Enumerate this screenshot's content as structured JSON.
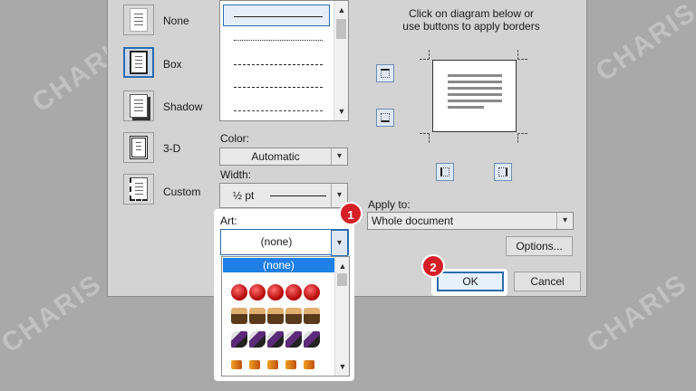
{
  "settings": [
    {
      "label": "None"
    },
    {
      "label": "Box"
    },
    {
      "label": "Shadow"
    },
    {
      "label": "3-D"
    },
    {
      "label": "Custom"
    }
  ],
  "color": {
    "label": "Color:",
    "value": "Automatic"
  },
  "width": {
    "label": "Width:",
    "value": "½ pt"
  },
  "art": {
    "label": "Art:",
    "value": "(none)",
    "list_selected": "(none)"
  },
  "preview": {
    "instructions_line1": "Click on diagram below or",
    "instructions_line2": "use buttons to apply borders"
  },
  "apply_to": {
    "label": "Apply to:",
    "value": "Whole document"
  },
  "buttons": {
    "options": "Options...",
    "ok": "OK",
    "cancel": "Cancel"
  },
  "callouts": [
    "1",
    "2"
  ],
  "watermark": "CHARIS",
  "colors": {
    "accent": "#1e80e6",
    "callout": "#d61f26",
    "dialog_bg": "#d3d3d3"
  }
}
